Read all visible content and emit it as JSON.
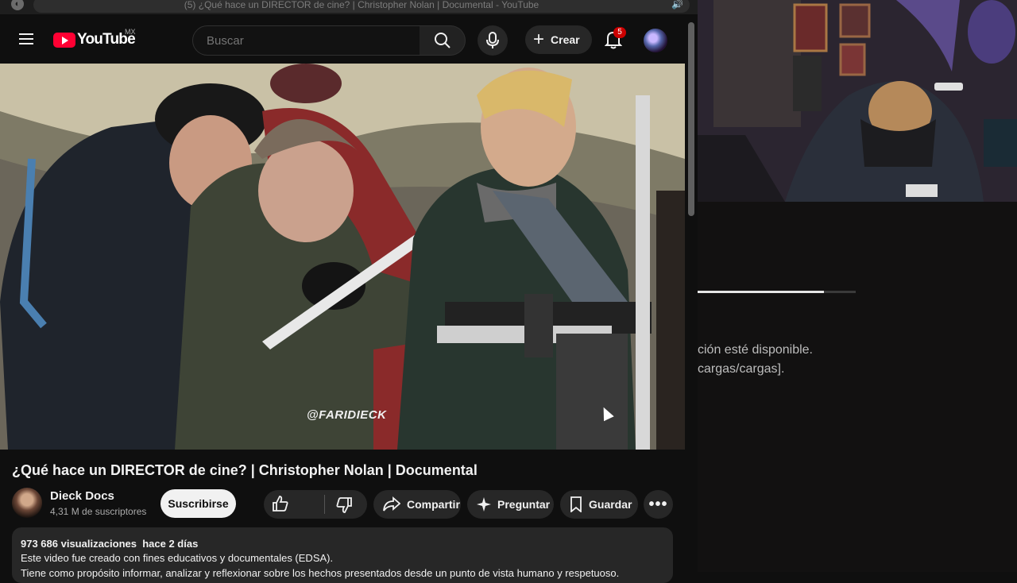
{
  "browser": {
    "tab_title": "(5) ¿Qué hace un DIRECTOR de cine? | Christopher Nolan | Documental - YouTube"
  },
  "header": {
    "logo_text": "YouTube",
    "region": "MX",
    "search_placeholder": "Buscar",
    "create_label": "Crear",
    "notification_count": "5"
  },
  "video": {
    "watermark": "@FARIDIECK",
    "title": "¿Qué hace un DIRECTOR de cine? | Christopher Nolan | Documental"
  },
  "channel": {
    "name": "Dieck Docs",
    "subscribers": "4,31 M de suscriptores",
    "subscribe_label": "Suscribirse"
  },
  "actions": {
    "share_label": "Compartir",
    "ask_label": "Preguntar",
    "save_label": "Guardar"
  },
  "description": {
    "views": "973 686 visualizaciones",
    "age": "hace 2 días",
    "line1": "Este video fue creado con fines educativos y documentales (EDSA).",
    "line2": "Tiene como propósito informar, analizar y reflexionar sobre los hechos presentados desde un punto de vista humano y respetuoso."
  },
  "right_pane": {
    "message_line1": "ción esté disponible.",
    "message_line2": "cargas/cargas].",
    "progress": 0.8
  },
  "colors": {
    "brand_red": "#ff0033",
    "background": "#0f0f0f",
    "badge_red": "#cc0000"
  },
  "icons": [
    "menu-icon",
    "search-icon",
    "mic-icon",
    "plus-icon",
    "bell-icon",
    "like-icon",
    "dislike-icon",
    "share-icon",
    "sparkle-icon",
    "bookmark-icon",
    "more-icon",
    "speaker-icon"
  ]
}
